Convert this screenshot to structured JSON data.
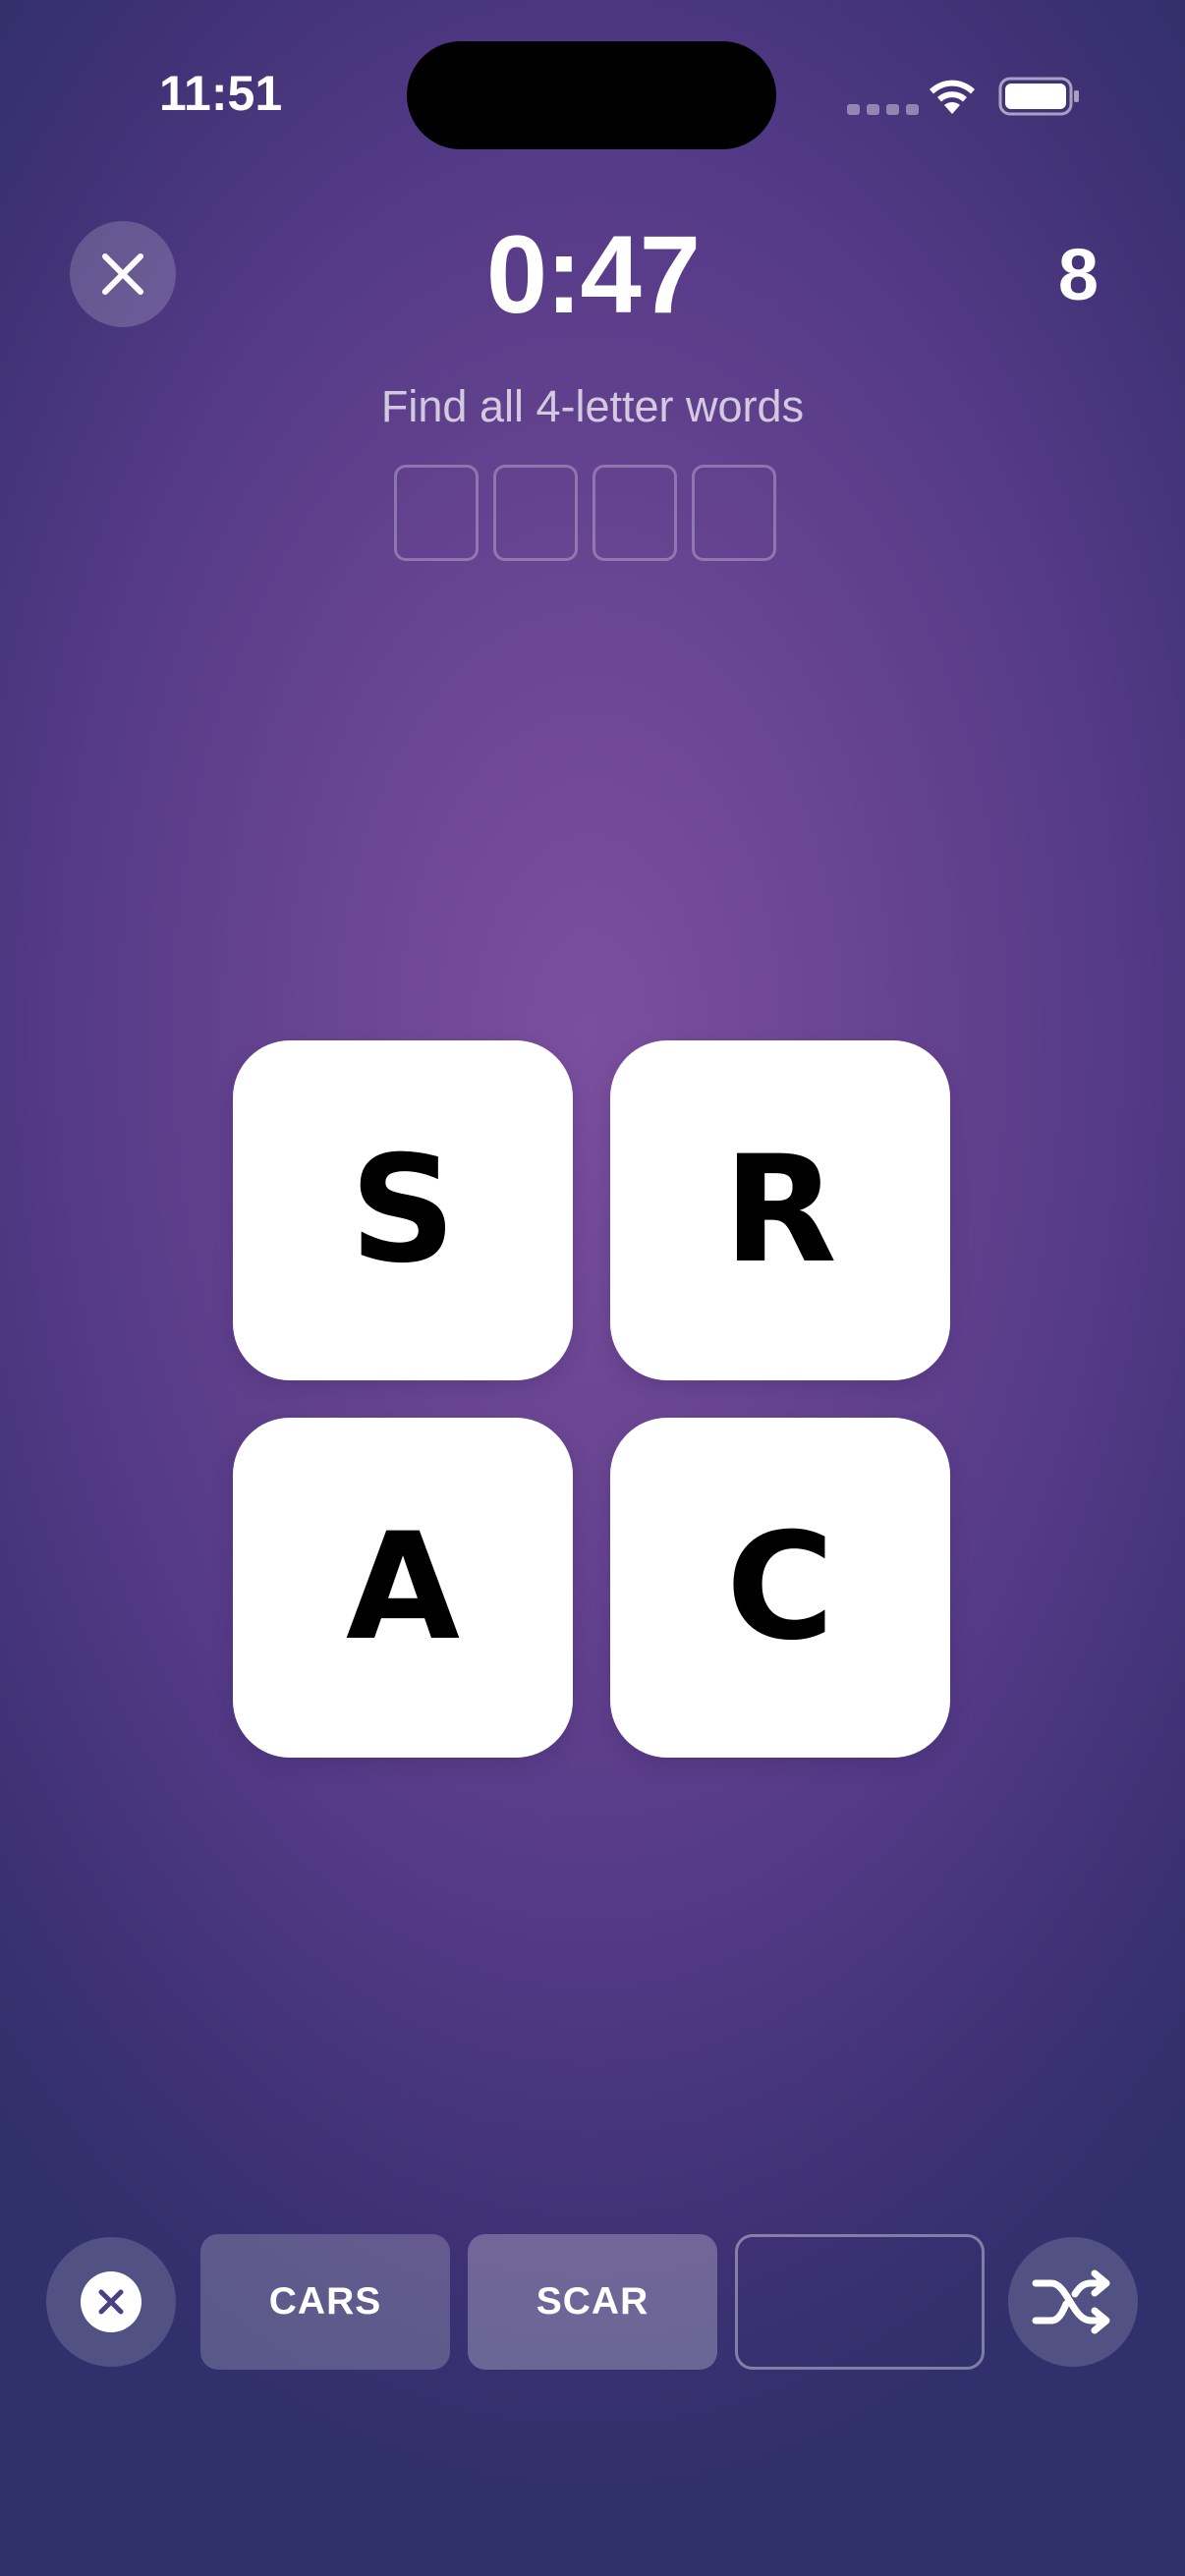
{
  "status_bar": {
    "time": "11:51",
    "icons": [
      "signal-dots-icon",
      "wifi-icon",
      "battery-icon"
    ]
  },
  "header": {
    "close_icon": "close-icon",
    "timer": "0:47",
    "score": "8"
  },
  "puzzle": {
    "instruction": "Find all 4-letter words",
    "slot_count": 4,
    "tiles": [
      "S",
      "R",
      "A",
      "C"
    ]
  },
  "found_words": {
    "clear_icon": "clear-circle-x-icon",
    "words": [
      "CARS",
      "SCAR",
      ""
    ],
    "shuffle_icon": "shuffle-icon"
  },
  "colors": {
    "background_center": "#7b4f9f",
    "background_edge": "#30306c",
    "tile": "#ffffff",
    "tile_letter": "#000000",
    "clear_x": "#4b3f86"
  }
}
